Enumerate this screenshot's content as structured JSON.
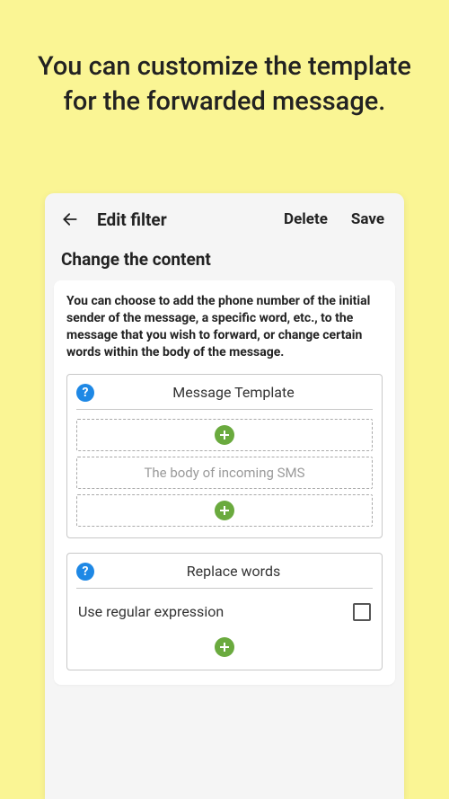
{
  "promo": {
    "line1": "You can customize the template",
    "line2": "for the forwarded message."
  },
  "appbar": {
    "title": "Edit filter",
    "delete": "Delete",
    "save": "Save"
  },
  "section": {
    "title": "Change the content",
    "description": "You can choose to add the phone number of the initial sender of the message, a specific word, etc., to the message that you wish to forward, or change certain words within the body of the message."
  },
  "template": {
    "title": "Message Template",
    "body_placeholder": "The body of incoming SMS"
  },
  "replace": {
    "title": "Replace words",
    "regex_label": "Use regular expression"
  }
}
